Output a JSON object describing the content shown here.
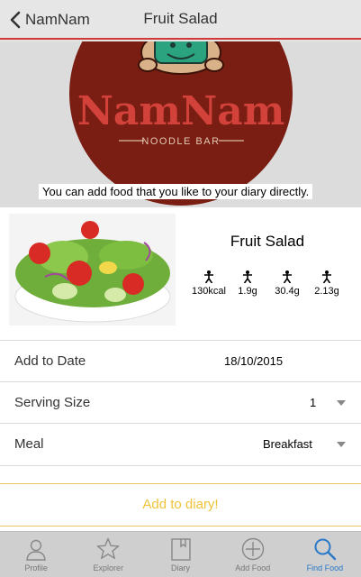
{
  "nav": {
    "back_label": "NamNam",
    "title": "Fruit Salad"
  },
  "hero": {
    "logo_name": "NamNam",
    "logo_sub": "NOODLE BAR",
    "caption": "You can add food that you like to your diary directly."
  },
  "food": {
    "name": "Fruit Salad",
    "image": "salad-bowl",
    "nutrients": [
      {
        "icon": "person-icon",
        "value": "130kcal"
      },
      {
        "icon": "person-icon",
        "value": "1.9g"
      },
      {
        "icon": "person-icon",
        "value": "30.4g"
      },
      {
        "icon": "person-icon",
        "value": "2.13g"
      }
    ]
  },
  "form": {
    "date_label": "Add to Date",
    "date_value": "18/10/2015",
    "serving_label": "Serving Size",
    "serving_value": "1",
    "meal_label": "Meal",
    "meal_value": "Breakfast"
  },
  "add_button": "Add to diary!",
  "tabs": [
    {
      "icon": "profile-icon",
      "label": "Profile"
    },
    {
      "icon": "star-icon",
      "label": "Explorer"
    },
    {
      "icon": "book-icon",
      "label": "Diary"
    },
    {
      "icon": "add-circle-icon",
      "label": "Add Food"
    },
    {
      "icon": "search-icon",
      "label": "Find Food"
    }
  ],
  "colors": {
    "accent_red": "#d23a3a",
    "logo_red": "#7a1d12",
    "button_gold": "#f0c33a",
    "active_tab": "#2a78c8"
  }
}
